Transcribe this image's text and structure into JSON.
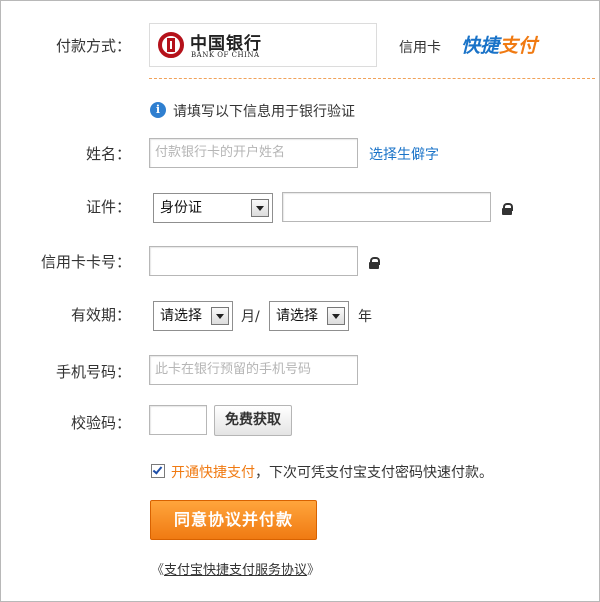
{
  "payment": {
    "label": "付款方式：",
    "bank_name_cn": "中国银行",
    "bank_name_en": "BANK OF CHINA",
    "card_type": "信用卡",
    "quick_pay_part1": "快捷",
    "quick_pay_part2": "支付"
  },
  "notice": {
    "text": "请填写以下信息用于银行验证"
  },
  "form": {
    "name_label": "姓名：",
    "name_placeholder": "付款银行卡的开户姓名",
    "rare_char_link": "选择生僻字",
    "id_label": "证件：",
    "id_type": "身份证",
    "card_label": "信用卡卡号：",
    "expiry_label": "有效期：",
    "month_select": "请选择",
    "month_unit": "月/",
    "year_select": "请选择",
    "year_unit": "年",
    "phone_label": "手机号码：",
    "phone_placeholder": "此卡在银行预留的手机号码",
    "code_label": "校验码：",
    "get_code_button": "免费获取"
  },
  "agreement": {
    "checked": true,
    "open_link": "开通快捷支付",
    "rest_text": "，下次可凭支付宝支付密码快速付款。",
    "submit_button": "同意协议并付款",
    "terms_prefix": "《",
    "terms_link": "支付宝快捷支付服务协议",
    "terms_suffix": "》"
  },
  "colors": {
    "accent_orange": "#f07a12",
    "link_blue": "#1a73c8",
    "quick_blue": "#1a73c8",
    "boc_red": "#b5121b"
  }
}
